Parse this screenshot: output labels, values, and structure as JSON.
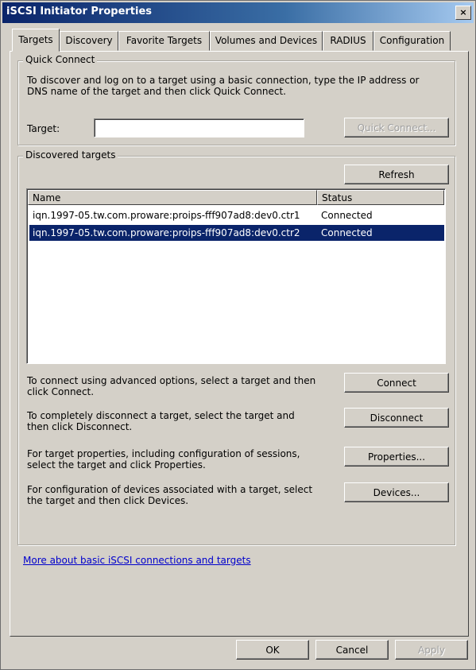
{
  "window": {
    "title": "iSCSI Initiator Properties",
    "close_symbol": "×"
  },
  "tabs": [
    {
      "label": "Targets",
      "active": true
    },
    {
      "label": "Discovery"
    },
    {
      "label": "Favorite Targets"
    },
    {
      "label": "Volumes and Devices"
    },
    {
      "label": "RADIUS"
    },
    {
      "label": "Configuration"
    }
  ],
  "quick_connect": {
    "legend": "Quick Connect",
    "description_line1": "To discover and log on to a target using a basic connection, type the IP address or",
    "description_line2": "DNS name of the target and then click Quick Connect.",
    "target_label": "Target:",
    "target_value": "",
    "button": "Quick Connect..."
  },
  "discovered": {
    "legend": "Discovered targets",
    "refresh_button": "Refresh",
    "columns": [
      "Name",
      "Status"
    ],
    "rows": [
      {
        "name": "iqn.1997-05.tw.com.proware:proips-fff907ad8:dev0.ctr1",
        "status": "Connected",
        "selected": false
      },
      {
        "name": "iqn.1997-05.tw.com.proware:proips-fff907ad8:dev0.ctr2",
        "status": "Connected",
        "selected": true
      }
    ],
    "connect_text_1": "To connect using advanced options, select a target and then",
    "connect_text_2": "click Connect.",
    "connect_button": "Connect",
    "disconnect_text_1": "To completely disconnect a target, select the target and",
    "disconnect_text_2": "then click Disconnect.",
    "disconnect_button": "Disconnect",
    "properties_text_1": "For target properties, including configuration of sessions,",
    "properties_text_2": "select the target and click Properties.",
    "properties_button": "Properties...",
    "devices_text_1": "For configuration of devices associated with a target, select",
    "devices_text_2": "the target and then click Devices.",
    "devices_button": "Devices..."
  },
  "link": "More about basic iSCSI connections and targets",
  "footer": {
    "ok": "OK",
    "cancel": "Cancel",
    "apply": "Apply"
  },
  "colors": {
    "selection": "#0a246a",
    "link": "#0000cc"
  }
}
